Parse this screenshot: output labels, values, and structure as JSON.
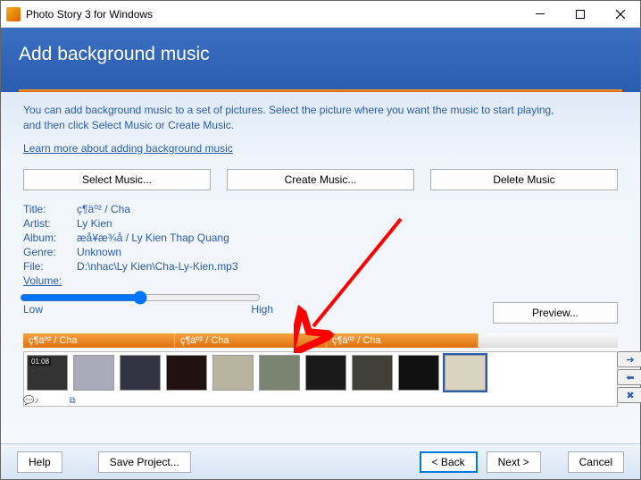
{
  "window": {
    "title": "Photo Story 3 for Windows"
  },
  "header": {
    "title": "Add background music"
  },
  "instruction": {
    "line1": "You can add background music to a set of pictures.  Select the picture where you want the music to start playing,",
    "line2": "and then click Select Music or Create Music."
  },
  "link": {
    "learn_more": "Learn more about adding background music"
  },
  "buttons": {
    "select_music": "Select Music...",
    "create_music": "Create Music...",
    "delete_music": "Delete Music",
    "preview": "Preview...",
    "help": "Help",
    "save_project": "Save Project...",
    "back": "< Back",
    "next": "Next >",
    "cancel": "Cancel"
  },
  "meta": {
    "labels": {
      "title": "Title:",
      "artist": "Artist:",
      "album": "Album:",
      "genre": "Genre:",
      "file": "File:",
      "volume": "Volume:"
    },
    "title": "ç¶ä⁰² / Cha",
    "artist": "Ly Kien",
    "album": "æå¥æ¾å / Ly Kien Thap Quang",
    "genre": "Unknown",
    "file": "D:\\nhac\\Ly Kien\\Cha-Ly-Kien.mp3"
  },
  "slider": {
    "low": "Low",
    "high": "High",
    "value": 50
  },
  "track": {
    "seg1": "ç¶äº² / Cha",
    "seg2": "ç¶äº² / Cha",
    "seg3": "ç¶äº² / Cha"
  },
  "filmstrip": {
    "timestamp": "01:08"
  }
}
